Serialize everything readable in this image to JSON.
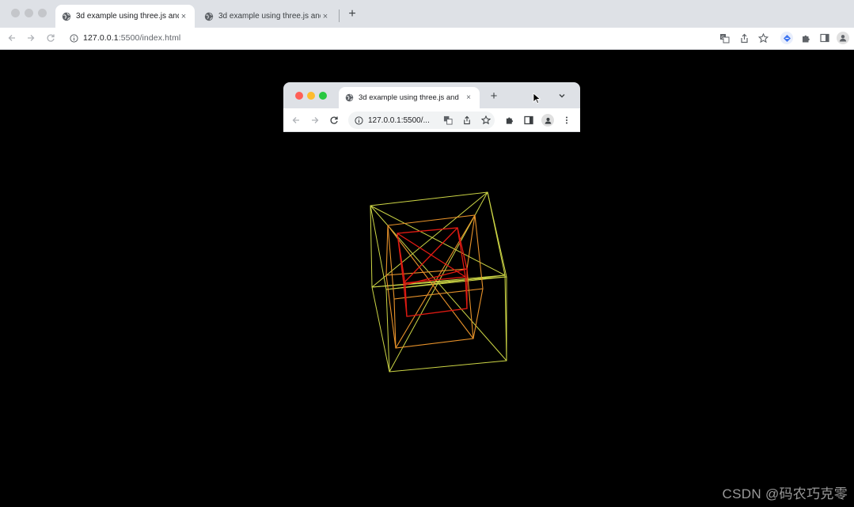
{
  "outer_browser": {
    "tabs": [
      {
        "title": "3d example using three.js and",
        "active": true
      },
      {
        "title": "3d example using three.js and",
        "active": false
      }
    ],
    "new_tab_label": "+",
    "close_glyph": "×",
    "url_host": "127.0.0.1",
    "url_rest": ":5500/index.html",
    "icons": [
      "back-icon",
      "forward-icon",
      "reload-icon",
      "info-icon",
      "translate-icon",
      "share-icon",
      "star-icon",
      "extension-badge-icon",
      "puzzle-icon",
      "sidebar-icon",
      "profile-icon"
    ]
  },
  "inner_browser": {
    "tab_title": "3d example using three.js and",
    "close_glyph": "×",
    "new_tab_label": "+",
    "url": "127.0.0.1:5500/...",
    "icons": [
      "back-icon",
      "forward-icon",
      "reload-icon",
      "info-icon",
      "translate-icon",
      "share-icon",
      "star-icon",
      "puzzle-icon",
      "sidebar-icon",
      "profile-icon",
      "menu-icon",
      "dropdown-icon",
      "cursor-icon"
    ],
    "traffic_colors": [
      "#ff5f57",
      "#febc2e",
      "#28c840"
    ]
  },
  "scene": {
    "background": "#000000",
    "cube_colors": {
      "outer": "#d9e24a",
      "middle": "#e8922a",
      "inner": "#e01a12"
    }
  },
  "watermark": "CSDN @码农巧克零"
}
